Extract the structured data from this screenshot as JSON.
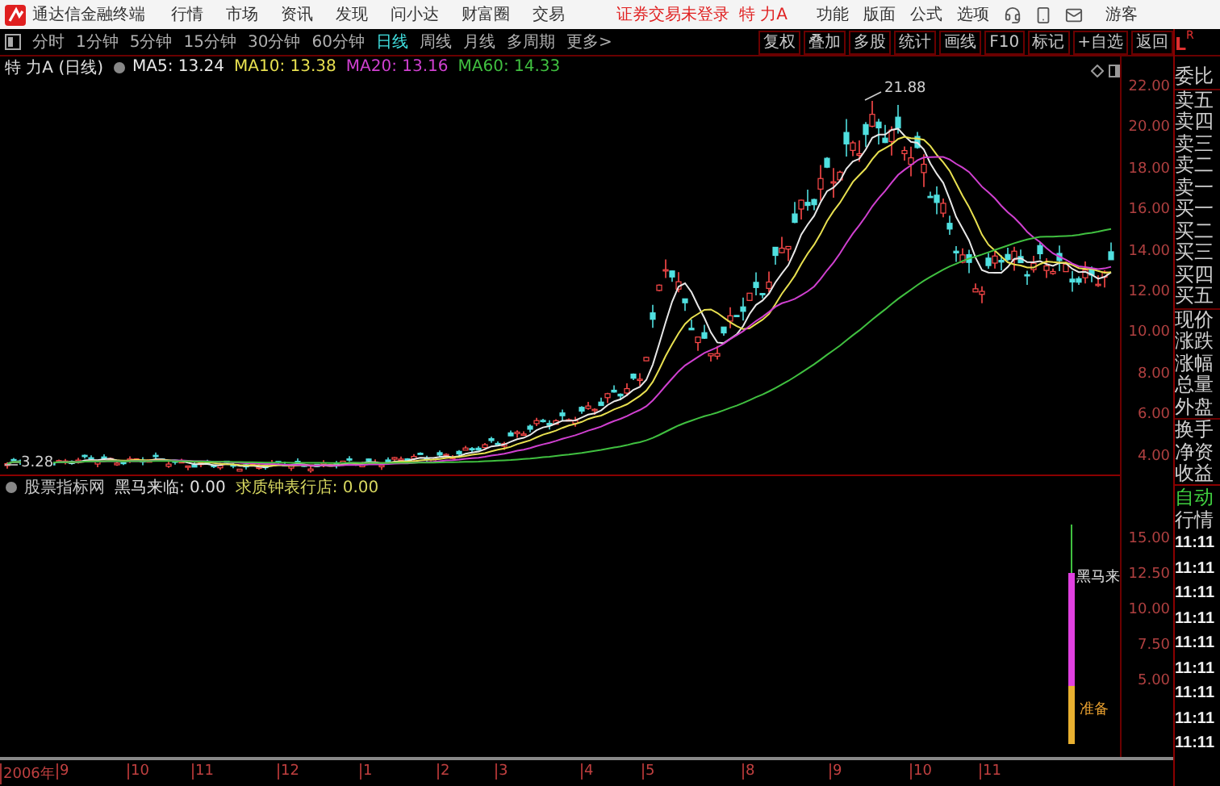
{
  "menu_bar": {
    "app_name": "通达信金融终端",
    "menus": [
      "行情",
      "市场",
      "资讯",
      "发现",
      "问小达",
      "财富圈",
      "交易"
    ],
    "status": "证券交易未登录",
    "stock": "特 力A",
    "right_menus": [
      "功能",
      "版面",
      "公式",
      "选项"
    ],
    "user": "游客"
  },
  "toolbar": {
    "periods": [
      {
        "label": "分时",
        "selected": false
      },
      {
        "label": "1分钟",
        "selected": false
      },
      {
        "label": "5分钟",
        "selected": false
      },
      {
        "label": "15分钟",
        "selected": false
      },
      {
        "label": "30分钟",
        "selected": false
      },
      {
        "label": "60分钟",
        "selected": false
      },
      {
        "label": "日线",
        "selected": true
      },
      {
        "label": "周线",
        "selected": false
      },
      {
        "label": "月线",
        "selected": false
      },
      {
        "label": "多周期",
        "selected": false
      },
      {
        "label": "更多>",
        "selected": false
      }
    ],
    "tools": [
      "复权",
      "叠加",
      "多股",
      "统计",
      "画线",
      "F10",
      "标记",
      "+自选",
      "返回"
    ]
  },
  "chart": {
    "title": "特 力A (日线)",
    "ma": [
      {
        "label": "MA5: 13.24",
        "color": "#e8e8e8"
      },
      {
        "label": "MA10: 13.38",
        "color": "#e8e050"
      },
      {
        "label": "MA20: 13.16",
        "color": "#d040d0"
      },
      {
        "label": "MA60: 14.33",
        "color": "#40c040"
      }
    ],
    "high_label": "21.88",
    "low_label": "3.28",
    "price_ticks": [
      "22.00",
      "20.00",
      "18.00",
      "16.00",
      "14.00",
      "12.00",
      "10.00",
      "8.00",
      "6.00",
      "4.00"
    ]
  },
  "indicator": {
    "name": "股票指标网",
    "values": [
      {
        "label": "黑马来临: 0.00",
        "color": "#e0e0e0"
      },
      {
        "label": "求质钟表行店: 0.00",
        "color": "#d8d860"
      }
    ],
    "ticks": [
      "15.00",
      "12.50",
      "10.00",
      "7.50",
      "5.00"
    ],
    "bar_labels": [
      "黑马来",
      "准备"
    ]
  },
  "date_axis": [
    "2006年",
    "9",
    "10",
    "11",
    "12",
    "1",
    "2",
    "3",
    "4",
    "5",
    "8",
    "9",
    "10",
    "11"
  ],
  "quote_panel": {
    "corner": "L",
    "corner_sub": "R",
    "groups": [
      [
        "委比"
      ],
      [
        "卖五",
        "卖四",
        "卖三",
        "卖二",
        "卖一",
        "买一",
        "买二",
        "买三",
        "买四",
        "买五"
      ],
      [
        "现价",
        "涨跌",
        "涨幅",
        "总量",
        "外盘"
      ],
      [
        "换手",
        "净资",
        "收益"
      ]
    ],
    "auto": "自动",
    "market": "行情",
    "times": [
      "11:11",
      "11:11",
      "11:11",
      "11:11",
      "11:11",
      "11:11",
      "11:11",
      "11:11",
      "11:11"
    ]
  }
}
